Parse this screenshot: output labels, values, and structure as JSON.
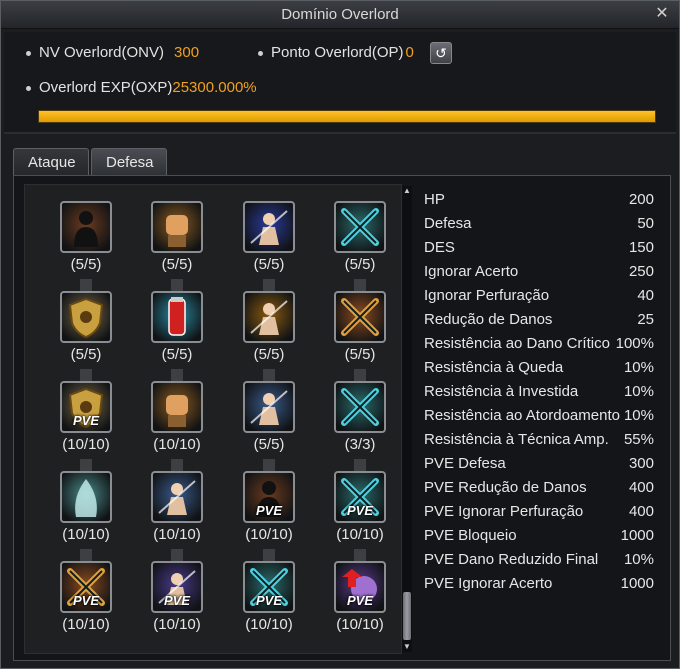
{
  "window": {
    "title": "Domínio Overlord"
  },
  "header": {
    "nv_label": "NV Overlord(ONV)",
    "nv_value": "300",
    "ponto_label": "Ponto Overlord(OP)",
    "ponto_value": "0",
    "exp_label": "Overlord EXP(OXP)",
    "exp_value": "25300.000%",
    "exp_bar_fill_fraction": 1.0
  },
  "tabs": [
    {
      "label": "Ataque",
      "active": false
    },
    {
      "label": "Defesa",
      "active": true
    }
  ],
  "skills": [
    {
      "icon": "shadow-figure-icon",
      "level": "(5/5)",
      "pve": false,
      "color": "#6a3a20"
    },
    {
      "icon": "iron-fist-icon",
      "level": "(5/5)",
      "pve": false,
      "color": "#8a5a20"
    },
    {
      "icon": "blue-warrior-icon",
      "level": "(5/5)",
      "pve": false,
      "color": "#2a3a9a"
    },
    {
      "icon": "crossed-blades-icon",
      "level": "(5/5)",
      "pve": false,
      "color": "#2a6a6a"
    },
    {
      "icon": "golden-shield-icon",
      "level": "(5/5)",
      "pve": false,
      "color": "#7a6a4a"
    },
    {
      "icon": "red-potion-icon",
      "level": "(5/5)",
      "pve": false,
      "color": "#2a8aa0"
    },
    {
      "icon": "flaming-muscle-icon",
      "level": "(5/5)",
      "pve": false,
      "color": "#8a5a10"
    },
    {
      "icon": "crossed-claws-icon",
      "level": "(5/5)",
      "pve": false,
      "color": "#8a4a20"
    },
    {
      "icon": "golden-shield-icon",
      "level": "(10/10)",
      "pve": true,
      "color": "#7a6a4a"
    },
    {
      "icon": "iron-fist-icon",
      "level": "(10/10)",
      "pve": false,
      "color": "#8a5a20"
    },
    {
      "icon": "lightning-warrior-icon",
      "level": "(5/5)",
      "pve": false,
      "color": "#3a5a8a"
    },
    {
      "icon": "crossed-blades-icon",
      "level": "(3/3)",
      "pve": false,
      "color": "#2a6a6a"
    },
    {
      "icon": "spirit-aura-icon",
      "level": "(10/10)",
      "pve": false,
      "color": "#4a8a8a"
    },
    {
      "icon": "lightning-warrior-icon",
      "level": "(10/10)",
      "pve": false,
      "color": "#3a5a8a"
    },
    {
      "icon": "shadow-figure-icon",
      "level": "(10/10)",
      "pve": true,
      "color": "#6a3a20"
    },
    {
      "icon": "crossed-blades-icon",
      "level": "(10/10)",
      "pve": true,
      "color": "#2a6a6a"
    },
    {
      "icon": "crossed-claws-icon",
      "level": "(10/10)",
      "pve": true,
      "color": "#8a4a20"
    },
    {
      "icon": "muscle-warrior-icon",
      "level": "(10/10)",
      "pve": true,
      "color": "#4a3a8a"
    },
    {
      "icon": "crossed-blades-icon",
      "level": "(10/10)",
      "pve": true,
      "color": "#2a6a6a"
    },
    {
      "icon": "red-arrow-up-icon",
      "level": "(10/10)",
      "pve": true,
      "color": "#5a3a8a"
    }
  ],
  "stats": [
    {
      "name": "HP",
      "value": "200"
    },
    {
      "name": "Defesa",
      "value": "50"
    },
    {
      "name": "DES",
      "value": "150"
    },
    {
      "name": "Ignorar Acerto",
      "value": "250"
    },
    {
      "name": "Ignorar Perfuração",
      "value": "40"
    },
    {
      "name": "Redução de Danos",
      "value": "25"
    },
    {
      "name": "Resistência ao Dano Crítico",
      "value": "100%"
    },
    {
      "name": "Resistência à Queda",
      "value": "10%"
    },
    {
      "name": "Resistência à Investida",
      "value": "10%"
    },
    {
      "name": "Resistência ao Atordoamento",
      "value": "10%"
    },
    {
      "name": "Resistência à Técnica Amp.",
      "value": "55%"
    },
    {
      "name": "PVE Defesa",
      "value": "300"
    },
    {
      "name": "PVE Redução de Danos",
      "value": "400"
    },
    {
      "name": "PVE Ignorar Perfuração",
      "value": "400"
    },
    {
      "name": "PVE Bloqueio",
      "value": "1000"
    },
    {
      "name": "PVE Dano Reduzido Final",
      "value": "10%"
    },
    {
      "name": "PVE Ignorar Acerto",
      "value": "1000"
    }
  ],
  "pve_badge": "PVE"
}
